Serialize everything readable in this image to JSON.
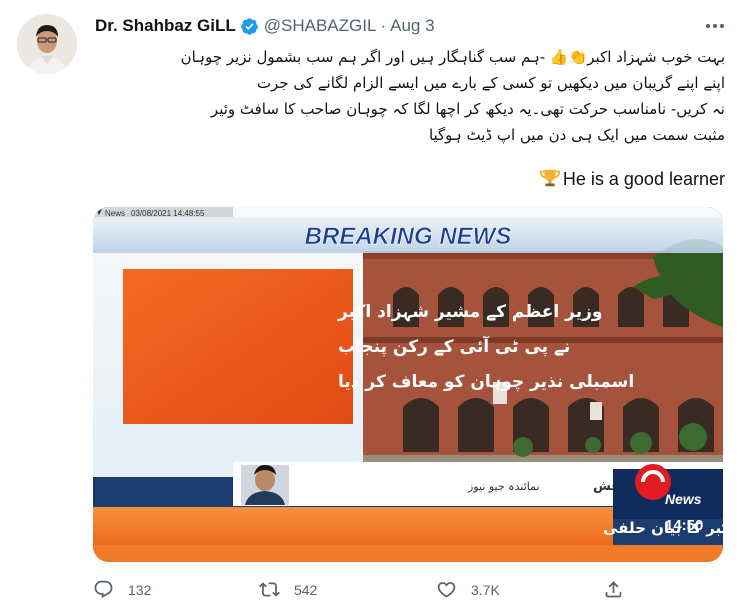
{
  "author": {
    "display_name": "Dr. Shahbaz GiLL",
    "handle": "@SHABAZGIL",
    "separator": "·",
    "date": "Aug 3",
    "verified": true
  },
  "tweet": {
    "urdu_lines": [
      "بہت خوب شہزاد اکبر👏👍 -ہم سب گناہگار ہیں اور اگر ہم سب بشمول نزیر چوہان",
      "اپنے اپنے گریبان میں دیکھیں تو کسی کے بارے میں ایسے الزام لگانے کی جرت",
      "نہ کریں- نامناسب حرکت تھی۔یہ دیکھ کر اچھا لگا کہ چوہان صاحب کا سافٹ وئیر",
      "مثبت سمت میں ایک ہی دن میں اپ ڈیٹ ہوگیا"
    ],
    "english": "He is a good learner",
    "english_emoji": "trophy-icon"
  },
  "media": {
    "channel_tag": "News",
    "timestamp": "03/08/2021 14:48:55",
    "banner": "BREAKING NEWS",
    "headline_lines": [
      "وزیر اعظم کے مشیر شہزاد اکبر",
      "نے پی ٹی آئی کے رکن پنجاب",
      "اسمبلی نذیر چوہان کو معاف کر دیا"
    ],
    "reporter_name": "ذیشان بخش",
    "reporter_title": "نمائندہ جیو نیوز",
    "logo_text": "News",
    "clock": "14:50",
    "ticker": "لاہور: نذیر چوہان نے اپنی غلطی تسلیم کرلی ہے، شہزاد اکبر کا بیان حلفی",
    "colors": {
      "orange": "#f15a1f",
      "banner": "#ffffff",
      "ticker_band": "#f47a2a"
    }
  },
  "actions": {
    "reply_count": "132",
    "retweet_count": "542",
    "like_count": "3.7K"
  }
}
